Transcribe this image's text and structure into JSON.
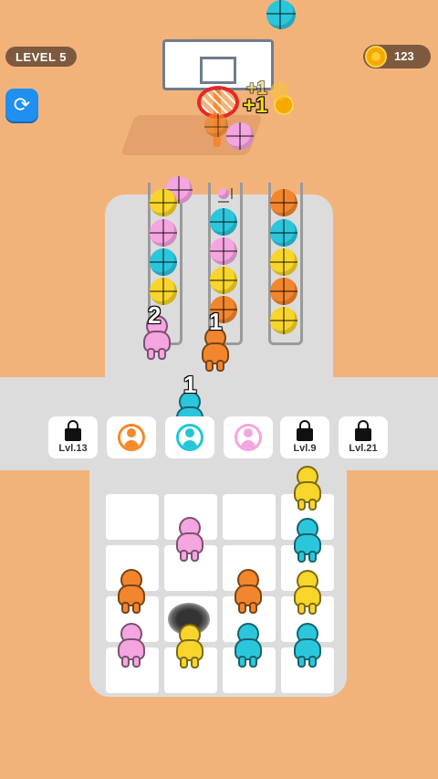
{
  "hud": {
    "level_label": "LEVEL 5",
    "coins": "123",
    "restart_icon": "refresh-icon"
  },
  "hoop": {
    "plus_one": "+1"
  },
  "slots": [
    {
      "type": "locked",
      "label": "Lvl.13"
    },
    {
      "type": "color",
      "color": "#f58a2a"
    },
    {
      "type": "color",
      "color": "#22c6d8"
    },
    {
      "type": "color",
      "color": "#f5a5e0"
    },
    {
      "type": "locked",
      "label": "Lvl.9"
    },
    {
      "type": "locked",
      "label": "Lvl.21"
    }
  ],
  "players_numbers": {
    "pink": "2",
    "orange": "1",
    "cyan": "1"
  },
  "colors": {
    "yellow": "#f8d52a",
    "pink": "#f5a5e0",
    "cyan": "#2cc6dc",
    "orange": "#f2862d",
    "floor": "#dcdcdc",
    "sand": "#f2b37b"
  }
}
